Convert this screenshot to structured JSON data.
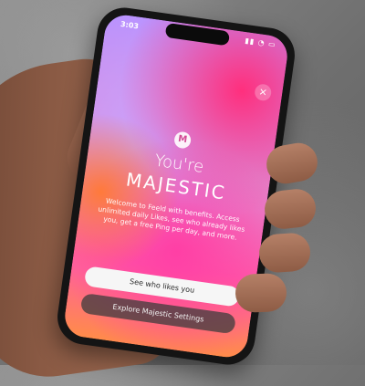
{
  "colors": {
    "accent_pink": "#ff3fa5",
    "accent_purple": "#b993ff",
    "accent_orange": "#ff8b4a"
  },
  "status_bar": {
    "time": "3:03",
    "icons": "▮▮ ◔ ▭"
  },
  "modal": {
    "close_icon": "×",
    "badge_letter": "M",
    "title_line1": "You're",
    "title_line2": "MAJESTIC",
    "body": "Welcome to Feeld with benefits. Access unlimited daily Likes, see who already likes you, get a free Ping per day, and more.",
    "primary_button": "See who likes you",
    "secondary_button": "Explore Majestic Settings"
  }
}
